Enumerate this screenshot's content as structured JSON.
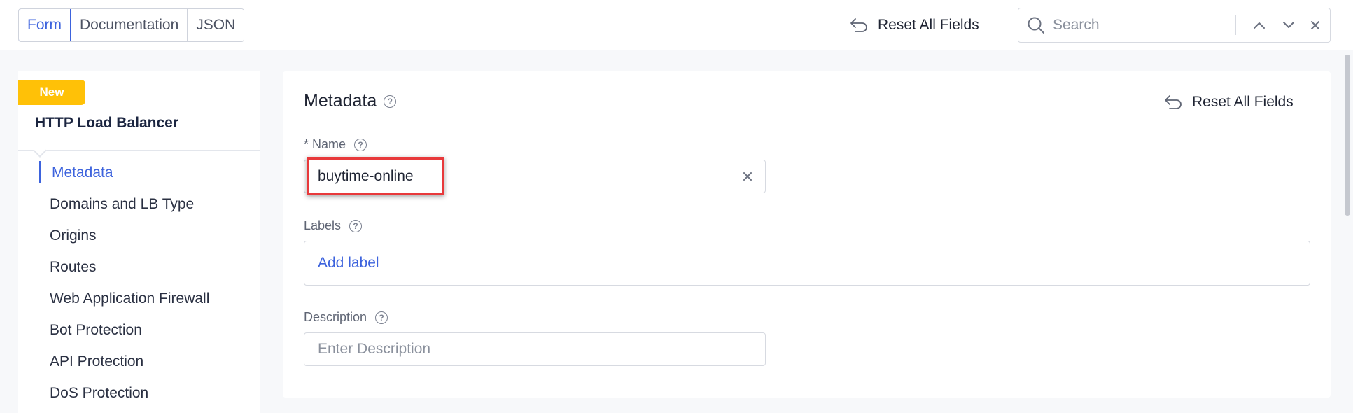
{
  "top_bar": {
    "view_tabs": [
      {
        "label": "Form",
        "active": true
      },
      {
        "label": "Documentation",
        "active": false
      },
      {
        "label": "JSON",
        "active": false
      }
    ],
    "reset_all_label": "Reset All Fields",
    "search": {
      "placeholder": "Search",
      "value": ""
    }
  },
  "sidebar": {
    "badge": "New",
    "title": "HTTP Load Balancer",
    "items": [
      {
        "label": "Metadata",
        "active": true
      },
      {
        "label": "Domains and LB Type",
        "active": false
      },
      {
        "label": "Origins",
        "active": false
      },
      {
        "label": "Routes",
        "active": false
      },
      {
        "label": "Web Application Firewall",
        "active": false
      },
      {
        "label": "Bot Protection",
        "active": false
      },
      {
        "label": "API Protection",
        "active": false
      },
      {
        "label": "DoS Protection",
        "active": false
      }
    ]
  },
  "main": {
    "section_title": "Metadata",
    "reset_all_label": "Reset All Fields",
    "name_field": {
      "label": "* Name",
      "value": "buytime-online"
    },
    "labels_field": {
      "label": "Labels",
      "add_label": "Add label"
    },
    "description_field": {
      "label": "Description",
      "placeholder": "Enter Description",
      "value": ""
    }
  },
  "colors": {
    "accent": "#3d63dd",
    "badge": "#ffc107",
    "highlight": "#e8393b"
  },
  "icons": {
    "reset": "return-arrow-icon",
    "search": "search-icon",
    "help": "question-circle-icon",
    "clear": "close-icon"
  }
}
